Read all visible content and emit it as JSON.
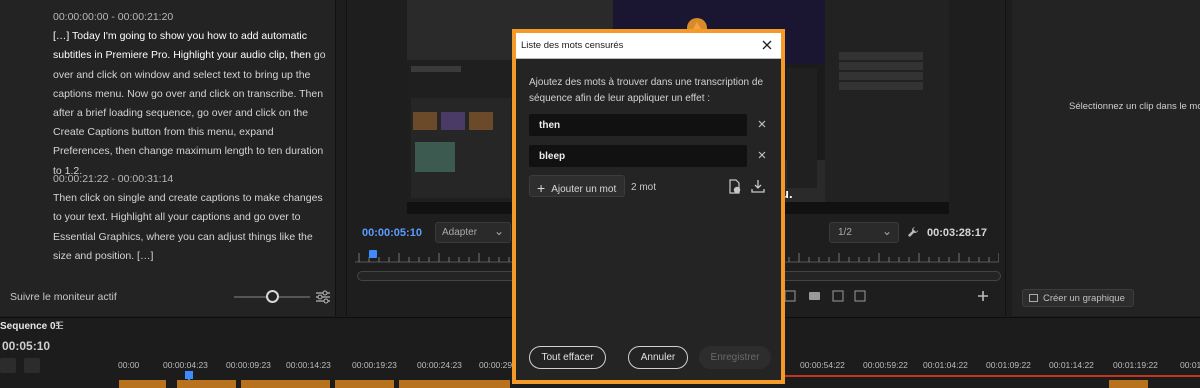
{
  "transcript": {
    "entries": [
      {
        "time": "00:00:00:00 - 00:00:21:20",
        "text_pre": "[…] Today I'm going to show you how to add automatic subtitles in Premiere Pro. Highlight your audio clip, then",
        "text_post": " go over and click on window and select text to bring up the captions menu. Now go over and click on transcribe. Then after a brief loading sequence, go over and click on the Create Captions button from this menu, expand Preferences, then change maximum length to ten duration to 1.2."
      },
      {
        "time": "00:00:21:22 - 00:00:31:14",
        "text_pre": "",
        "text_post": "Then click on single and create captions to make changes to your text. Highlight all your captions and go over to Essential Graphics, where you can adjust things like the size and position. […]"
      }
    ],
    "follow_label": "Suivre le moniteur actif"
  },
  "monitor": {
    "time_left": "00:00:05:10",
    "fit_option": "Adapter",
    "resolution": "1/2",
    "time_right": "00:03:28:17",
    "caption_fragment": "u."
  },
  "right_panel": {
    "message": "Sélectionnez un clip dans le montage",
    "create_graphic_label": "Créer un graphique"
  },
  "timeline": {
    "sequence_name": "Sequence 01",
    "current_time": "00:05:10",
    "ticks": [
      "00:00",
      "00:00:04:23",
      "00:00:09:23",
      "00:00:14:23",
      "00:00:19:23",
      "00:00:24:23",
      "00:00:29",
      "00:00:54:22",
      "00:00:59:22",
      "00:01:04:22",
      "00:01:09:22",
      "00:01:14:22",
      "00:01:19:22",
      "00:01:24"
    ]
  },
  "dialog": {
    "title": "Liste des mots censurés",
    "description": "Ajoutez des mots à trouver dans une transcription de séquence afin de leur appliquer un effet :",
    "words": [
      "then",
      "bleep"
    ],
    "add_word_label": "Ajouter un mot",
    "word_count": "2 mot",
    "clear_label": "Tout effacer",
    "cancel_label": "Annuler",
    "save_label": "Enregistrer"
  },
  "colors": {
    "accent_blue": "#3d8bff",
    "highlight_border": "#f39a29",
    "clip_orange": "#b8721e",
    "marker_red": "#c2341c"
  }
}
